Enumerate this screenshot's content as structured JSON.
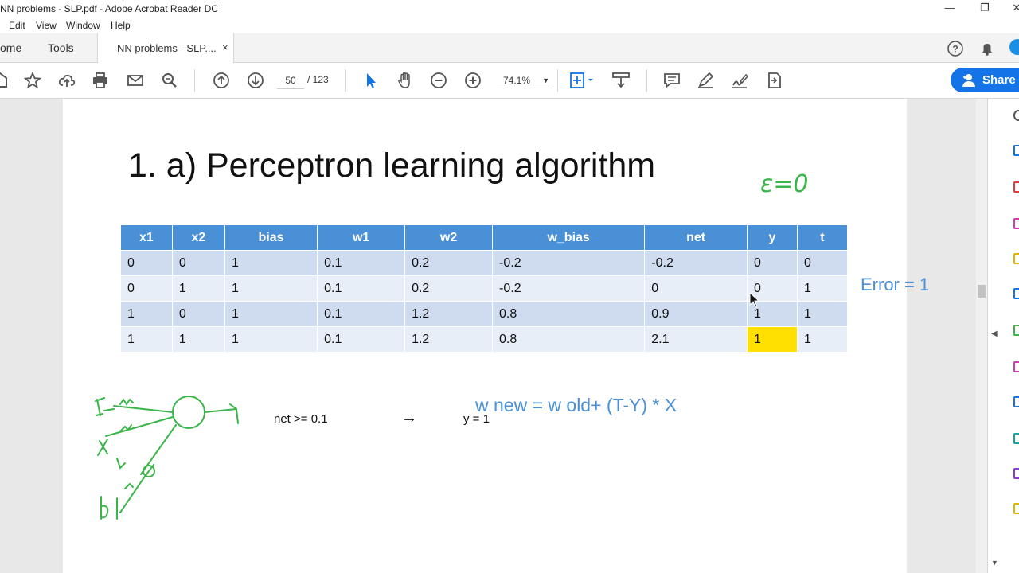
{
  "window": {
    "title": "NN problems - SLP.pdf - Adobe Acrobat Reader DC"
  },
  "menu": {
    "items": [
      "Edit",
      "View",
      "Window",
      "Help"
    ]
  },
  "tabs": {
    "home": "ome",
    "tools": "Tools",
    "doc": "NN problems - SLP....",
    "close": "×"
  },
  "toolbar": {
    "page_current": "50",
    "page_separator": "/ 123",
    "zoom": "74.1%",
    "share_label": "Share"
  },
  "pdf": {
    "title": "1. a) Perceptron learning algorithm",
    "table": {
      "headers": [
        "x1",
        "x2",
        "bias",
        "w1",
        "w2",
        "w_bias",
        "net",
        "y",
        "t"
      ],
      "rows": [
        [
          "0",
          "0",
          "1",
          "0.1",
          "0.2",
          "-0.2",
          "-0.2",
          "0",
          "0"
        ],
        [
          "0",
          "1",
          "1",
          "0.1",
          "0.2",
          "-0.2",
          "0",
          "0",
          "1"
        ],
        [
          "1",
          "0",
          "1",
          "0.1",
          "1.2",
          "0.8",
          "0.9",
          "1",
          "1"
        ],
        [
          "1",
          "1",
          "1",
          "0.1",
          "1.2",
          "0.8",
          "2.1",
          "1",
          "1"
        ]
      ]
    },
    "rule": "net >= 0.1",
    "arrow": "→",
    "y_out": "y = 1",
    "update": "w new = w old+ (T-Y) * X",
    "error": "Error = 1",
    "epsilon": "ε=0",
    "highlight_color": "#ffe000",
    "header_color": "#4a90d6"
  }
}
